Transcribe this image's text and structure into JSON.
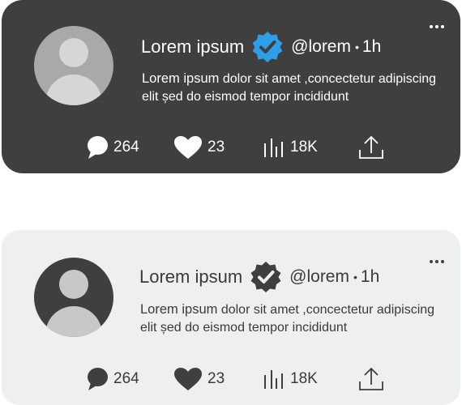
{
  "cards": [
    {
      "theme": "dark",
      "name": "Lorem ipsum",
      "handle": "@lorem",
      "separator": "•",
      "time": "1h",
      "verified_icon": "verified-badge-icon",
      "verified_color": "#2f9ee9",
      "text_lead": "Lorem ipsum",
      "text_rest": " dolor sit amet ,concectetur adipiscing elit șed do eismod tempor incididunt",
      "actions": {
        "replies": "264",
        "likes": "23",
        "views": "18K"
      }
    },
    {
      "theme": "light",
      "name": "Lorem ipsum",
      "handle": "@lorem",
      "separator": "•",
      "time": "1h",
      "verified_icon": "verified-badge-icon",
      "verified_color": "#3f3f3f",
      "text_lead": "Lorem ipsum",
      "text_rest": " dolor sit amet ,concectetur adipiscing elit șed do eismod tempor incididunt",
      "actions": {
        "replies": "264",
        "likes": "23",
        "views": "18K"
      }
    }
  ]
}
